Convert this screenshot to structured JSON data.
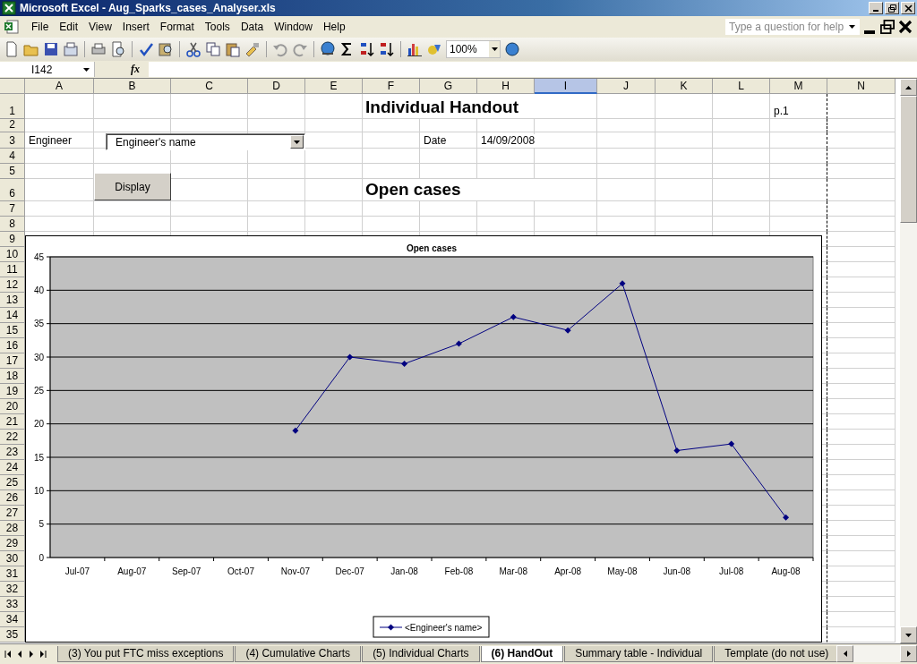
{
  "window": {
    "title": "Microsoft Excel - Aug_Sparks_cases_Analyser.xls"
  },
  "menu": [
    "File",
    "Edit",
    "View",
    "Insert",
    "Format",
    "Tools",
    "Data",
    "Window",
    "Help"
  ],
  "help_search": {
    "placeholder": "Type a question for help"
  },
  "toolbar": {
    "zoom": "100%"
  },
  "formula_bar": {
    "name_box": "I142",
    "function_label": "fx"
  },
  "columns": [
    {
      "label": "A",
      "selected": false
    },
    {
      "label": "B",
      "selected": false
    },
    {
      "label": "C",
      "selected": false
    },
    {
      "label": "D",
      "selected": false
    },
    {
      "label": "E",
      "selected": false
    },
    {
      "label": "F",
      "selected": false
    },
    {
      "label": "G",
      "selected": false
    },
    {
      "label": "H",
      "selected": false
    },
    {
      "label": "I",
      "selected": true
    },
    {
      "label": "J",
      "selected": false
    },
    {
      "label": "K",
      "selected": false
    },
    {
      "label": "L",
      "selected": false
    },
    {
      "label": "M",
      "selected": false
    },
    {
      "label": "N",
      "selected": false
    }
  ],
  "rows": [
    "1",
    "2",
    "3",
    "4",
    "5",
    "6",
    "7",
    "8",
    "9",
    "10",
    "11",
    "12",
    "13",
    "14",
    "15",
    "16",
    "17",
    "18",
    "19",
    "20",
    "21",
    "22",
    "23",
    "24",
    "25",
    "26",
    "27",
    "28",
    "29",
    "30",
    "31",
    "32",
    "33",
    "34",
    "35"
  ],
  "cells": [
    {
      "text": "Individual Handout",
      "kind": "heading"
    },
    {
      "text": "p.1",
      "kind": "plain"
    },
    {
      "text": "Engineer",
      "kind": "plain"
    },
    {
      "text": "Date",
      "kind": "plain"
    },
    {
      "text": "14/09/2008",
      "kind": "plain"
    },
    {
      "text": "Open cases",
      "kind": "heading"
    }
  ],
  "engineer_dropdown": {
    "value": "Engineer's name"
  },
  "display_button": "Display",
  "chart": {
    "chart_data": {
      "type": "line",
      "title": "Open cases",
      "categories": [
        "Jul-07",
        "Aug-07",
        "Sep-07",
        "Oct-07",
        "Nov-07",
        "Dec-07",
        "Jan-08",
        "Feb-08",
        "Mar-08",
        "Apr-08",
        "May-08",
        "Jun-08",
        "Jul-08",
        "Aug-08"
      ],
      "grid": true,
      "series": [
        {
          "name": "<Engineer's name>",
          "color": "#000080",
          "marker": "diamond",
          "values": [
            null,
            null,
            null,
            null,
            19,
            30,
            29,
            32,
            36,
            34,
            41,
            16,
            17,
            6
          ]
        }
      ],
      "ylim": [
        0,
        45
      ],
      "yticks": [
        0,
        5,
        10,
        15,
        20,
        25,
        30,
        35,
        40,
        45
      ]
    }
  },
  "sheet_tabs": [
    {
      "label": "(3) You put FTC miss exceptions",
      "selected": false
    },
    {
      "label": "(4) Cumulative Charts",
      "selected": false
    },
    {
      "label": "(5) Individual Charts",
      "selected": false
    },
    {
      "label": "(6) HandOut",
      "selected": true
    },
    {
      "label": "Summary table - Individual",
      "selected": false
    },
    {
      "label": "Template (do not use)",
      "selected": false
    }
  ]
}
